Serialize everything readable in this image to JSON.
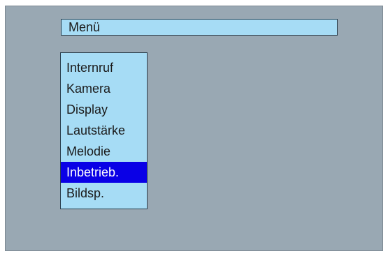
{
  "header": {
    "title": "Menü"
  },
  "menu": {
    "items": [
      {
        "label": "Internruf"
      },
      {
        "label": "Kamera"
      },
      {
        "label": "Display"
      },
      {
        "label": "Lautstärke"
      },
      {
        "label": "Melodie"
      },
      {
        "label": "Inbetrieb."
      },
      {
        "label": "Bildsp."
      }
    ],
    "selected_index": 5
  },
  "colors": {
    "background": "#99a8b3",
    "panel": "#a6dcf5",
    "selected": "#0a00e6",
    "border": "#2b3f4d"
  }
}
